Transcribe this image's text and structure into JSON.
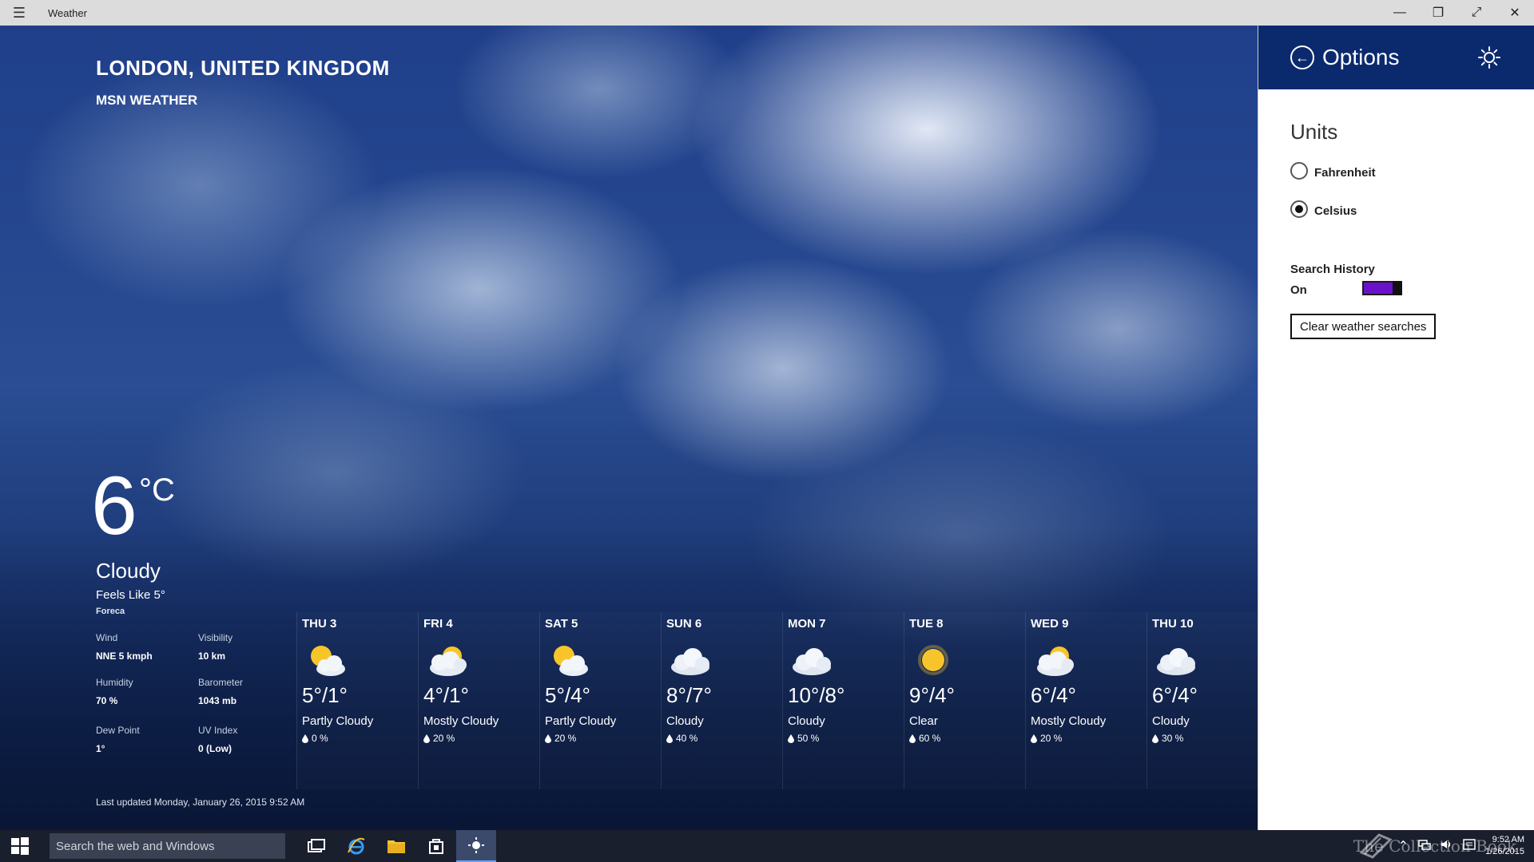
{
  "window": {
    "title": "Weather",
    "controls": [
      "—",
      "❐",
      "⤢",
      "✕"
    ]
  },
  "location": {
    "city": "LONDON, UNITED KINGDOM",
    "provider": "MSN WEATHER"
  },
  "current": {
    "temp": "6",
    "unit": "°C",
    "condition": "Cloudy",
    "feels_like": "Feels Like 5°",
    "source": "Foreca",
    "details": [
      {
        "label": "Wind",
        "value": "NNE 5 kmph"
      },
      {
        "label": "Visibility",
        "value": "10 km"
      },
      {
        "label": "Humidity",
        "value": "70 %"
      },
      {
        "label": "Barometer",
        "value": "1043 mb"
      },
      {
        "label": "Dew Point",
        "value": "1°"
      },
      {
        "label": "UV Index",
        "value": "0 (Low)"
      }
    ],
    "updated": "Last updated Monday, January 26, 2015 9:52 AM"
  },
  "forecast": [
    {
      "day": "THU 3",
      "hilo": "5°/1°",
      "desc": "Partly Cloudy",
      "precip": "0 %",
      "icon": "partly-cloudy-icon"
    },
    {
      "day": "FRI 4",
      "hilo": "4°/1°",
      "desc": "Mostly Cloudy",
      "precip": "20 %",
      "icon": "mostly-cloudy-icon"
    },
    {
      "day": "SAT 5",
      "hilo": "5°/4°",
      "desc": "Partly Cloudy",
      "precip": "20 %",
      "icon": "partly-cloudy-icon"
    },
    {
      "day": "SUN 6",
      "hilo": "8°/7°",
      "desc": "Cloudy",
      "precip": "40 %",
      "icon": "cloudy-icon"
    },
    {
      "day": "MON 7",
      "hilo": "10°/8°",
      "desc": "Cloudy",
      "precip": "50 %",
      "icon": "cloudy-icon"
    },
    {
      "day": "TUE 8",
      "hilo": "9°/4°",
      "desc": "Clear",
      "precip": "60 %",
      "icon": "sun-icon"
    },
    {
      "day": "WED 9",
      "hilo": "6°/4°",
      "desc": "Mostly Cloudy",
      "precip": "20 %",
      "icon": "mostly-cloudy-icon"
    },
    {
      "day": "THU 10",
      "hilo": "6°/4°",
      "desc": "Cloudy",
      "precip": "30 %",
      "icon": "cloudy-icon"
    }
  ],
  "options": {
    "title": "Options",
    "units_heading": "Units",
    "fahrenheit": "Fahrenheit",
    "celsius": "Celsius",
    "selected_unit": "Celsius",
    "search_history_label": "Search History",
    "search_history_state": "On",
    "search_history_on": true,
    "clear_button": "Clear weather searches",
    "accent_color": "#6a12c9",
    "header_color": "#0b2a6e"
  },
  "taskbar": {
    "search_placeholder": "Search the web and Windows",
    "time": "9:52 AM",
    "date": "1/26/2015",
    "watermark": "The Collection Book"
  }
}
